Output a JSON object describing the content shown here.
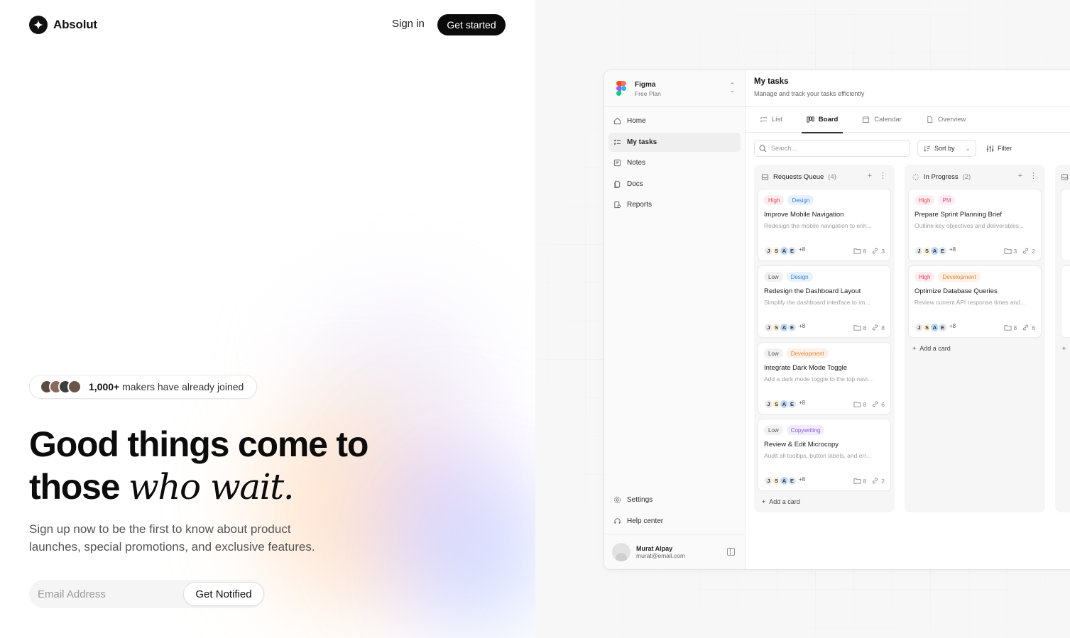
{
  "brand": {
    "name": "Absolut"
  },
  "header": {
    "signin_label": "Sign in",
    "cta_label": "Get started"
  },
  "hero": {
    "joined_count": "1,000+",
    "joined_text": " makers have already joined",
    "headline_line1": "Good things come to",
    "headline_line2_plain": "those ",
    "headline_line2_italic": "who wait.",
    "subtext": "Sign up now to be the first to know about product launches, special promotions, and exclusive features.",
    "email_placeholder": "Email Address",
    "notify_label": "Get Notified",
    "avatar_colors": [
      "#5a4a42",
      "#8a6a5a",
      "#3d3d3d",
      "#6b5548"
    ]
  },
  "app": {
    "workspace": {
      "name": "Figma",
      "plan": "Free Plan"
    },
    "nav": [
      {
        "label": "Home",
        "icon": "home-icon"
      },
      {
        "label": "My tasks",
        "icon": "tasks-icon",
        "active": true
      },
      {
        "label": "Notes",
        "icon": "note-icon"
      },
      {
        "label": "Docs",
        "icon": "doc-icon"
      },
      {
        "label": "Reports",
        "icon": "report-icon"
      }
    ],
    "nav_bottom": [
      {
        "label": "Settings",
        "icon": "gear-icon"
      },
      {
        "label": "Help center",
        "icon": "headset-icon"
      }
    ],
    "user": {
      "name": "Murat Alpay",
      "email": "murat@email.com"
    },
    "page": {
      "title": "My tasks",
      "subtitle": "Manage and track your tasks efficiently"
    },
    "tabs": [
      {
        "label": "List",
        "icon": "list-icon"
      },
      {
        "label": "Board",
        "icon": "board-icon",
        "active": true
      },
      {
        "label": "Calendar",
        "icon": "calendar-icon"
      },
      {
        "label": "Overview",
        "icon": "file-icon"
      }
    ],
    "toolbar": {
      "search_placeholder": "Search...",
      "sort_label": "Sort by",
      "filter_label": "Filter"
    },
    "add_card_label": "Add a card",
    "assignee_initials": [
      "J",
      "S",
      "A",
      "E"
    ],
    "assignee_more": "+8",
    "columns": [
      {
        "title": "Requests Queue",
        "count": "(4)",
        "cards": [
          {
            "tags": [
              {
                "text": "High",
                "kind": "high"
              },
              {
                "text": "Design",
                "kind": "design"
              }
            ],
            "title": "Improve Mobile Navigation",
            "desc": "Redesign the mobile navigation to enh...",
            "files": "8",
            "links": "3"
          },
          {
            "tags": [
              {
                "text": "Low",
                "kind": "low"
              },
              {
                "text": "Design",
                "kind": "design"
              }
            ],
            "title": "Redesign the Dashboard Layout",
            "desc": "Simplify the dashboard interface to im...",
            "files": "8",
            "links": "8"
          },
          {
            "tags": [
              {
                "text": "Low",
                "kind": "low"
              },
              {
                "text": "Development",
                "kind": "dev"
              }
            ],
            "title": "Integrate Dark Mode Toggle",
            "desc": "Add a dark mode toggle to the top navi...",
            "files": "8",
            "links": "6"
          },
          {
            "tags": [
              {
                "text": "Low",
                "kind": "low"
              },
              {
                "text": "Copywriting",
                "kind": "copy"
              }
            ],
            "title": "Review & Edit Microcopy",
            "desc": "Audit all tooltips, button labels, and err...",
            "files": "8",
            "links": "2"
          }
        ]
      },
      {
        "title": "In Progress",
        "count": "(2)",
        "cards": [
          {
            "tags": [
              {
                "text": "High",
                "kind": "high"
              },
              {
                "text": "PM",
                "kind": "pm"
              }
            ],
            "title": "Prepare Sprint Planning Brief",
            "desc": "Outline key objectives and deliverables...",
            "files": "3",
            "links": "2"
          },
          {
            "tags": [
              {
                "text": "High",
                "kind": "high"
              },
              {
                "text": "Development",
                "kind": "dev"
              }
            ],
            "title": "Optimize Database Queries",
            "desc": "Review current API response times and...",
            "files": "8",
            "links": "6"
          }
        ]
      }
    ],
    "tag_colors": {
      "high": {
        "bg": "#fdecee",
        "fg": "#e0455a"
      },
      "low": {
        "bg": "#f1f1f1",
        "fg": "#555555"
      },
      "design": {
        "bg": "#e8f2fd",
        "fg": "#3a82d6"
      },
      "dev": {
        "bg": "#fdf0e6",
        "fg": "#e08a3a"
      },
      "copy": {
        "bg": "#f1ecfd",
        "fg": "#8a5ad6"
      },
      "pm": {
        "bg": "#fdecf3",
        "fg": "#e0558a"
      }
    },
    "assignee_colors": [
      "#e9e9e9",
      "#fbf1d8",
      "#bcd8f7",
      "#dbe7f5"
    ]
  }
}
